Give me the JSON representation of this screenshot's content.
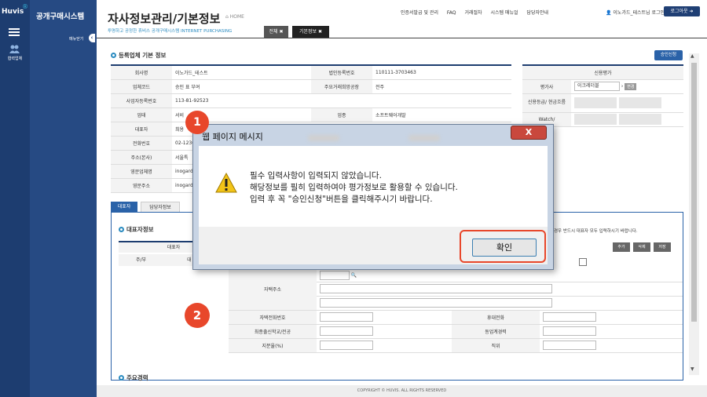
{
  "brand": {
    "logo": "Huvis",
    "logo_mark": "®",
    "system_name": "공개구매시스템",
    "menu_hide": "메뉴닫기",
    "user_menu": "협력업체"
  },
  "header": {
    "title": "자사정보관리/기본정보",
    "home": "HOME",
    "tagline": "투명하고 공정한 휴비스 공개구매시스템  INTERNET PURCHASING",
    "nav": [
      "인증서발급 및 관리",
      "FAQ",
      "거래절차",
      "시스템 매뉴얼",
      "담당자안내"
    ],
    "user": "이노가드_테스트님 로그인중",
    "logout": "로그아웃"
  },
  "tabs": {
    "all": "전체",
    "basic": "기본정보"
  },
  "section1": {
    "title": "등록업체 기본 정보",
    "approve_button": "승인신청"
  },
  "info": {
    "row1": {
      "l1": "회사명",
      "v1": "이노가드_테스트",
      "l2": "법인등록번호",
      "v2": "110111-3703463"
    },
    "row2": {
      "l1": "업체코드",
      "v1": "승인 표 부여",
      "l2": "주요거래희망공장",
      "v2": "전주"
    },
    "row3": {
      "l1": "사업자등록번호",
      "v1": "113-81-92523"
    },
    "row4": {
      "l1": "업태",
      "v1": "서비",
      "l2": "업종",
      "v2": "소프트웨어개발"
    },
    "row5": {
      "l1": "대표자",
      "v1": "최용"
    },
    "row6": {
      "l1": "전화번호",
      "v1": "02-1230"
    },
    "row7": {
      "l1": "주소(본사)",
      "v1": "서울특"
    },
    "row8": {
      "l1": "영문업체명",
      "v1": "inogard"
    },
    "row9": {
      "l1": "영문주소",
      "v1": "inogard"
    }
  },
  "credit": {
    "header": "신용평가",
    "agency_label": "평가사",
    "agency_value": "이크레더블",
    "change": "변경",
    "grade_label": "신용등급/ 현금흐름",
    "watch_label": "Watch/"
  },
  "rep_tabs": {
    "rep": "대표자",
    "mgr": "담당자정보"
  },
  "section2": {
    "title": "대표자정보",
    "note": "경우 반드시 대표자 모두 입력하시기 바랍니다.",
    "add": "추가",
    "del": "삭제",
    "save": "저장",
    "rep_head": "대표자",
    "col1": "주/부",
    "col2": "대"
  },
  "form": {
    "home_addr": "자택주소",
    "home_phone": "자택전화번호",
    "mobile": "휴대전화",
    "school": "최종출신학교/전공",
    "experience": "동업계경력",
    "ownership": "지분율(%)",
    "position": "직위"
  },
  "section3": {
    "title": "주요경력"
  },
  "footer": "COPYRIGHT © HUVIS. ALL RIGHTS RESERVED",
  "dialog": {
    "title": "웹 페이지 메시지",
    "close": "X",
    "lines": [
      "필수 입력사항이 입력되지 않았습니다.",
      "해당정보를 필히 입력하여야 평가정보로 활용할 수 있습니다.",
      "입력 후 꼭 \"승인신청\"버튼을 클릭해주시기 바랍니다."
    ],
    "ok": "확인"
  },
  "badges": {
    "one": "1",
    "two": "2"
  }
}
